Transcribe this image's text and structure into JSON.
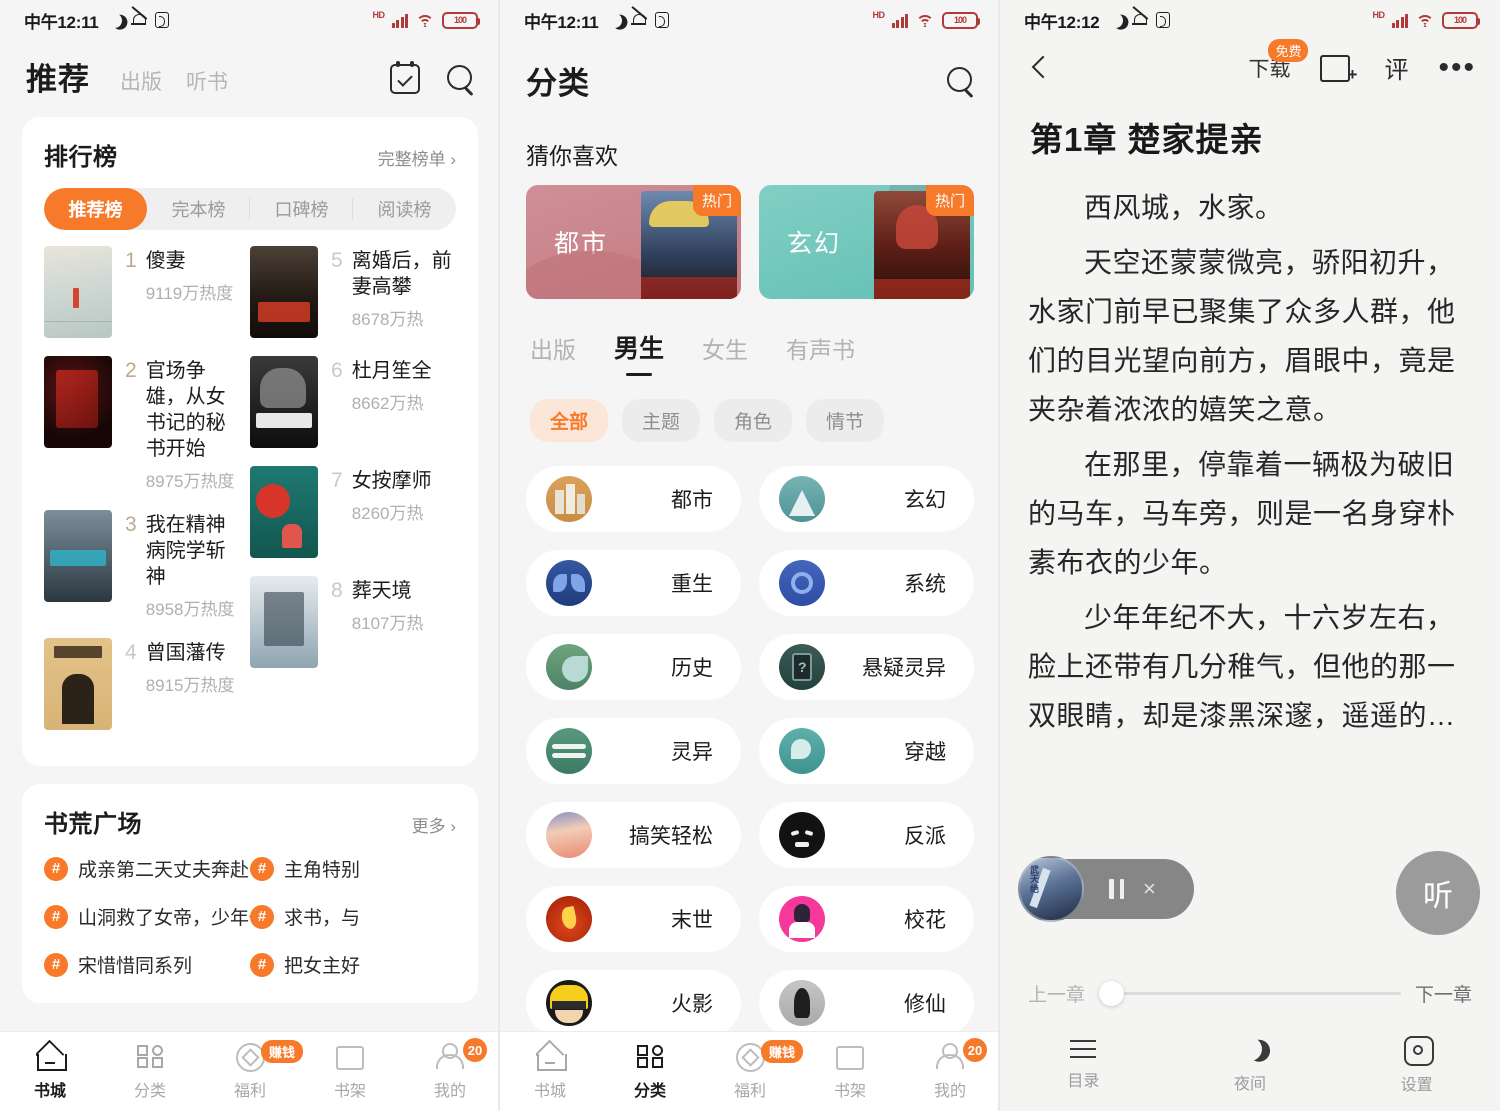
{
  "status_bar": {
    "time_left": "中午12:11",
    "time_right": "中午12:12",
    "hd": "HD",
    "battery": "100"
  },
  "screen1": {
    "title": "推荐",
    "tabs": [
      "出版",
      "听书"
    ],
    "icons": {
      "calendar": "calendar-check-icon",
      "search": "search-icon"
    },
    "ranking": {
      "title": "排行榜",
      "more": "完整榜单 ›",
      "segments": [
        "推荐榜",
        "完本榜",
        "口碑榜",
        "阅读榜"
      ],
      "active_segment": "推荐榜",
      "items": [
        {
          "rank": "1",
          "name": "傻妻",
          "heat": "9119万热度"
        },
        {
          "rank": "2",
          "name": "官场争雄，从女书记的秘书开始",
          "heat": "8975万热度"
        },
        {
          "rank": "3",
          "name": "我在精神病院学斩神",
          "heat": "8958万热度"
        },
        {
          "rank": "4",
          "name": "曾国藩传",
          "heat": "8915万热度"
        },
        {
          "rank": "5",
          "name": "离婚后，前妻高攀",
          "heat": "8678万热"
        },
        {
          "rank": "6",
          "name": "杜月笙全",
          "heat": "8662万热"
        },
        {
          "rank": "7",
          "name": "女按摩师",
          "heat": "8260万热"
        },
        {
          "rank": "8",
          "name": "葬天境",
          "heat": "8107万热"
        }
      ]
    },
    "plaza": {
      "title": "书荒广场",
      "more": "更多 ›",
      "tags": [
        "成亲第二天丈夫奔赴战场，…",
        "主角特别",
        "山洞救了女帝，少年修为一…",
        "求书，与",
        "宋惜惜同系列",
        "把女主好"
      ]
    },
    "tabbar": [
      {
        "label": "书城",
        "icon": "home-icon",
        "active": true
      },
      {
        "label": "分类",
        "icon": "grid-icon",
        "active": false
      },
      {
        "label": "福利",
        "icon": "coin-icon",
        "active": false,
        "badge": "赚钱"
      },
      {
        "label": "书架",
        "icon": "book-icon",
        "active": false
      },
      {
        "label": "我的",
        "icon": "user-icon",
        "active": false,
        "badge": "20"
      }
    ]
  },
  "screen2": {
    "title": "分类",
    "search_icon": "search-icon",
    "section_title": "猜你喜欢",
    "heroes": [
      {
        "label": "都市",
        "badge": "热门",
        "color": "#cc8790"
      },
      {
        "label": "玄幻",
        "badge": "热门",
        "color": "#74c7bd"
      }
    ],
    "tabs": [
      "出版",
      "男生",
      "女生",
      "有声书"
    ],
    "active_tab": "男生",
    "chips": [
      "全部",
      "主题",
      "角色",
      "情节"
    ],
    "active_chip": "全部",
    "categories": [
      {
        "label": "都市",
        "color": "#d79b52"
      },
      {
        "label": "玄幻",
        "color": "#6aaab0"
      },
      {
        "label": "重生",
        "color": "#2d52a0"
      },
      {
        "label": "系统",
        "color": "#3b5fb5"
      },
      {
        "label": "历史",
        "color": "#5d9475"
      },
      {
        "label": "悬疑灵异",
        "color": "#2d4744"
      },
      {
        "label": "灵异",
        "color": "#4f9078"
      },
      {
        "label": "穿越",
        "color": "#4fa39c"
      },
      {
        "label": "搞笑轻松",
        "color": "#e8a68d"
      },
      {
        "label": "反派",
        "color": "#101010"
      },
      {
        "label": "末世",
        "color": "#c2340f"
      },
      {
        "label": "校花",
        "color": "#f5399a"
      },
      {
        "label": "火影",
        "color": "#f2c617"
      },
      {
        "label": "修仙",
        "color": "#b4b4b4"
      }
    ],
    "tabbar": [
      {
        "label": "书城",
        "icon": "home-icon",
        "active": false
      },
      {
        "label": "分类",
        "icon": "grid-icon",
        "active": true
      },
      {
        "label": "福利",
        "icon": "coin-icon",
        "active": false,
        "badge": "赚钱"
      },
      {
        "label": "书架",
        "icon": "book-icon",
        "active": false
      },
      {
        "label": "我的",
        "icon": "user-icon",
        "active": false,
        "badge": "20"
      }
    ]
  },
  "screen3": {
    "back_icon": "back-arrow-icon",
    "download_label": "下载",
    "download_badge": "免费",
    "add_to_shelf_icon": "book-add-icon",
    "comment_label": "评",
    "more_icon": "more-dots-icon",
    "chapter_title": "第1章 楚家提亲",
    "paragraphs": [
      "西风城，水家。",
      "天空还蒙蒙微亮，骄阳初升，水家门前早已聚集了众多人群，他们的目光望向前方，眉眼中，竟是夹杂着浓浓的嬉笑之意。",
      "在那里，停靠着一辆极为破旧的马车，马车旁，则是一名身穿朴素布衣的少年。",
      "少年年纪不大，十六岁左右，脸上还带有几分稚气，但他的那一双眼睛，却是漆黑深邃，遥遥的…"
    ],
    "player": {
      "pause_icon": "pause-icon",
      "close_icon": "close-icon"
    },
    "listen_button": "听",
    "prev_chapter": "上一章",
    "next_chapter": "下一章",
    "bottom_bar": [
      {
        "label": "目录",
        "icon": "menu-icon"
      },
      {
        "label": "夜间",
        "icon": "moon-icon"
      },
      {
        "label": "设置",
        "icon": "gear-icon"
      }
    ]
  },
  "colors": {
    "accent": "#f7792a",
    "bg": "#f5f5f5",
    "reader_bg": "#f4f4f2"
  }
}
